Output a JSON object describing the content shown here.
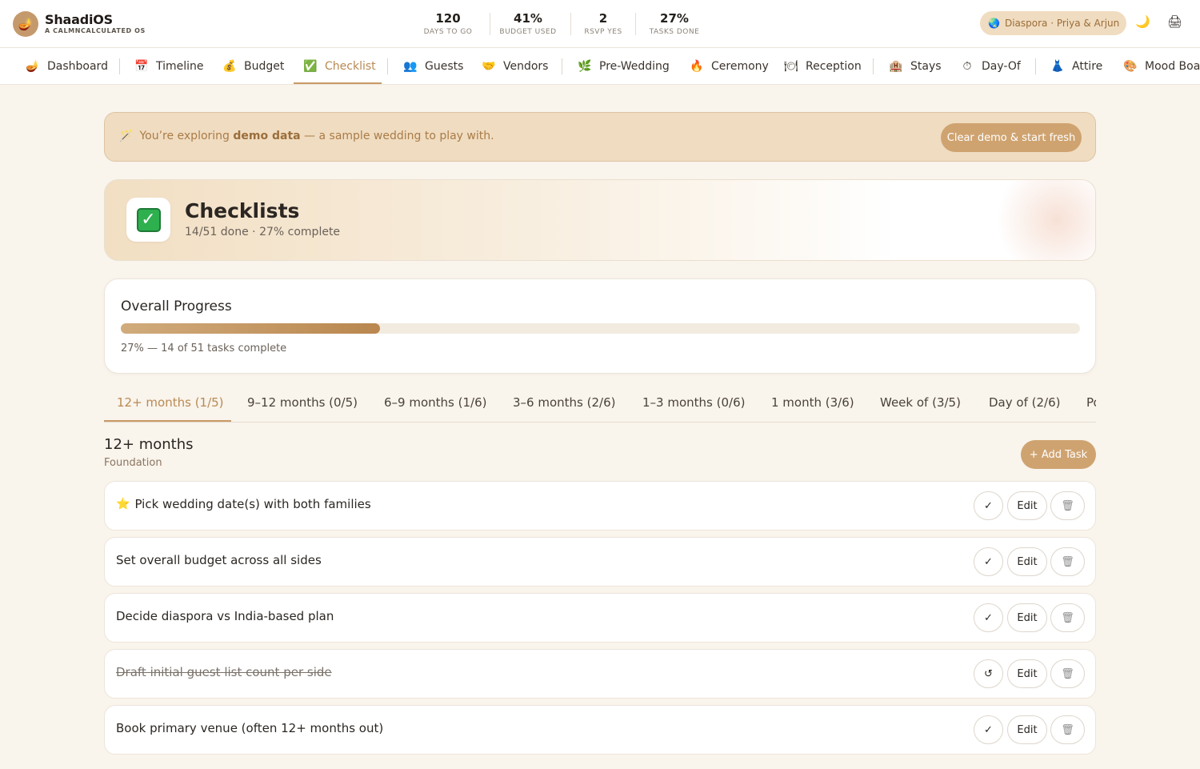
{
  "app": {
    "name": "ShaadiOS",
    "tagline": "A CALMNCALCULATED OS",
    "logo_icon": "diya-lamp-icon"
  },
  "stats": [
    {
      "value": "120",
      "label": "DAYS TO GO"
    },
    {
      "value": "41%",
      "label": "BUDGET USED"
    },
    {
      "value": "2",
      "label": "RSVP YES"
    },
    {
      "value": "27%",
      "label": "TASKS DONE"
    }
  ],
  "profile": {
    "label": "Diaspora · Priya & Arjun",
    "icon": "globe-icon"
  },
  "header_icons": [
    "moon-icon",
    "printer-icon"
  ],
  "nav": [
    {
      "label": "Dashboard",
      "icon": "diya-icon",
      "glyph": "🪔"
    },
    {
      "label": "Timeline",
      "icon": "calendar-icon",
      "glyph": "📅"
    },
    {
      "label": "Budget",
      "icon": "money-bag-icon",
      "glyph": "💰"
    },
    {
      "label": "Checklist",
      "icon": "checkbox-icon",
      "glyph": "✅",
      "active": true
    },
    {
      "label": "Guests",
      "icon": "people-icon",
      "glyph": "👥"
    },
    {
      "label": "Vendors",
      "icon": "handshake-icon",
      "glyph": "🤝"
    },
    {
      "label": "Pre-Wedding",
      "icon": "herb-icon",
      "glyph": "🌿"
    },
    {
      "label": "Ceremony",
      "icon": "fire-icon",
      "glyph": "🔥"
    },
    {
      "label": "Reception",
      "icon": "plate-icon",
      "glyph": "🍽"
    },
    {
      "label": "Stays",
      "icon": "hotel-icon",
      "glyph": "🏨"
    },
    {
      "label": "Day-Of",
      "icon": "stopwatch-icon",
      "glyph": "⏱"
    },
    {
      "label": "Attire",
      "icon": "saree-icon",
      "glyph": "👗"
    },
    {
      "label": "Mood Board",
      "icon": "palette-icon",
      "glyph": "🎨"
    }
  ],
  "demo_banner": {
    "prefix": "You’re exploring ",
    "highlight": "demo data",
    "suffix": " — a sample wedding to play with.",
    "button": "Clear demo & start fresh",
    "icon": "magic-wand-icon"
  },
  "page": {
    "title": "Checklists",
    "subtitle": "14/51 done · 27% complete",
    "icon": "checkbox-icon"
  },
  "progress": {
    "title": "Overall Progress",
    "percent": 27,
    "caption": "27% — 14 of 51 tasks complete"
  },
  "tabs": [
    {
      "label": "12+ months (1/5)",
      "active": true
    },
    {
      "label": "9–12 months (0/5)"
    },
    {
      "label": "6–9 months (1/6)"
    },
    {
      "label": "3–6 months (2/6)"
    },
    {
      "label": "1–3 months (0/6)"
    },
    {
      "label": "1 month (3/6)"
    },
    {
      "label": "Week of (3/5)"
    },
    {
      "label": "Day of (2/6)"
    },
    {
      "label": "Po"
    }
  ],
  "section": {
    "title": "12+ months",
    "subtitle": "Foundation",
    "add_button": "+ Add Task"
  },
  "tasks": [
    {
      "label": "Pick wedding date(s) with both families",
      "starred": true,
      "done": false,
      "toggle_icon": "✓"
    },
    {
      "label": "Set overall budget across all sides",
      "starred": false,
      "done": false,
      "toggle_icon": "✓"
    },
    {
      "label": "Decide diaspora vs India-based plan",
      "starred": false,
      "done": false,
      "toggle_icon": "✓"
    },
    {
      "label": "Draft initial guest list count per side",
      "starred": false,
      "done": true,
      "toggle_icon": "↺"
    },
    {
      "label": "Book primary venue (often 12+ months out)",
      "starred": false,
      "done": false,
      "toggle_icon": "✓"
    }
  ],
  "task_actions": {
    "edit": "Edit",
    "delete_icon": "trash-icon"
  },
  "colors": {
    "accent": "#c89a66",
    "background": "#f9f4ec",
    "banner": "#f0dcc0"
  }
}
